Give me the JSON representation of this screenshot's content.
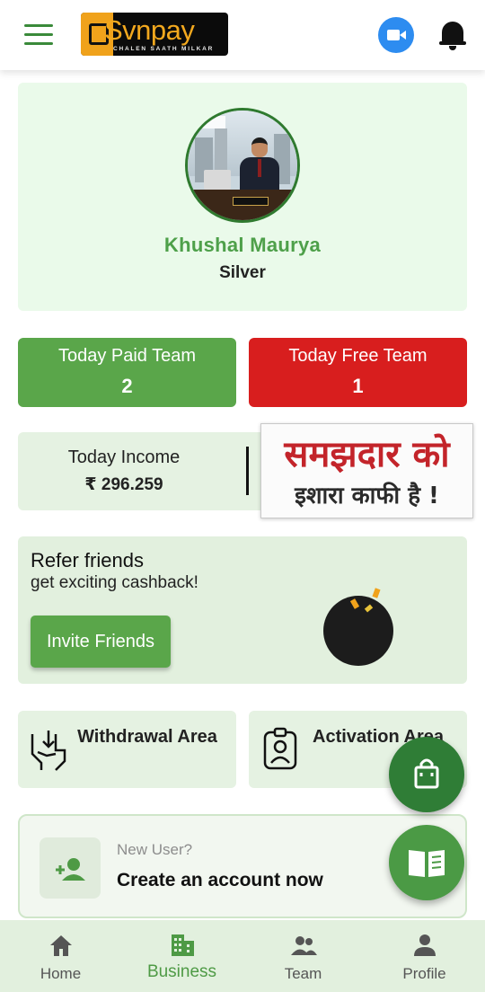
{
  "header": {
    "logo_text": "Svnpay",
    "logo_tagline": "CHALEN SAATH MILKAR",
    "icons": [
      "menu-icon",
      "video-icon",
      "bell-icon"
    ]
  },
  "profile": {
    "name": "Khushal Maurya",
    "rank": "Silver"
  },
  "team": {
    "paid_label": "Today Paid Team",
    "paid_value": "2",
    "free_label": "Today Free Team",
    "free_value": "1"
  },
  "income": {
    "label": "Today Income",
    "value": "₹ 296.259"
  },
  "banner": {
    "line1": "समझदार को",
    "line2": "इशारा काफी है !"
  },
  "refer": {
    "title": "Refer friends",
    "subtitle": "get exciting cashback!",
    "button": "Invite Friends"
  },
  "areas": {
    "withdrawal": "Withdrawal Area",
    "activation": "Activation Area"
  },
  "create_account": {
    "question": "New User?",
    "cta": "Create an account now"
  },
  "nav": {
    "items": [
      {
        "label": "Home",
        "icon": "home-icon"
      },
      {
        "label": "Business",
        "icon": "business-icon"
      },
      {
        "label": "Team",
        "icon": "team-icon"
      },
      {
        "label": "Profile",
        "icon": "profile-icon"
      }
    ],
    "active": "Business"
  },
  "colors": {
    "primary_green": "#5aa64a",
    "dark_green": "#2f7d36",
    "red": "#d81e1e",
    "card_bg": "#e5f2e2",
    "brand_orange": "#f2a81e"
  }
}
